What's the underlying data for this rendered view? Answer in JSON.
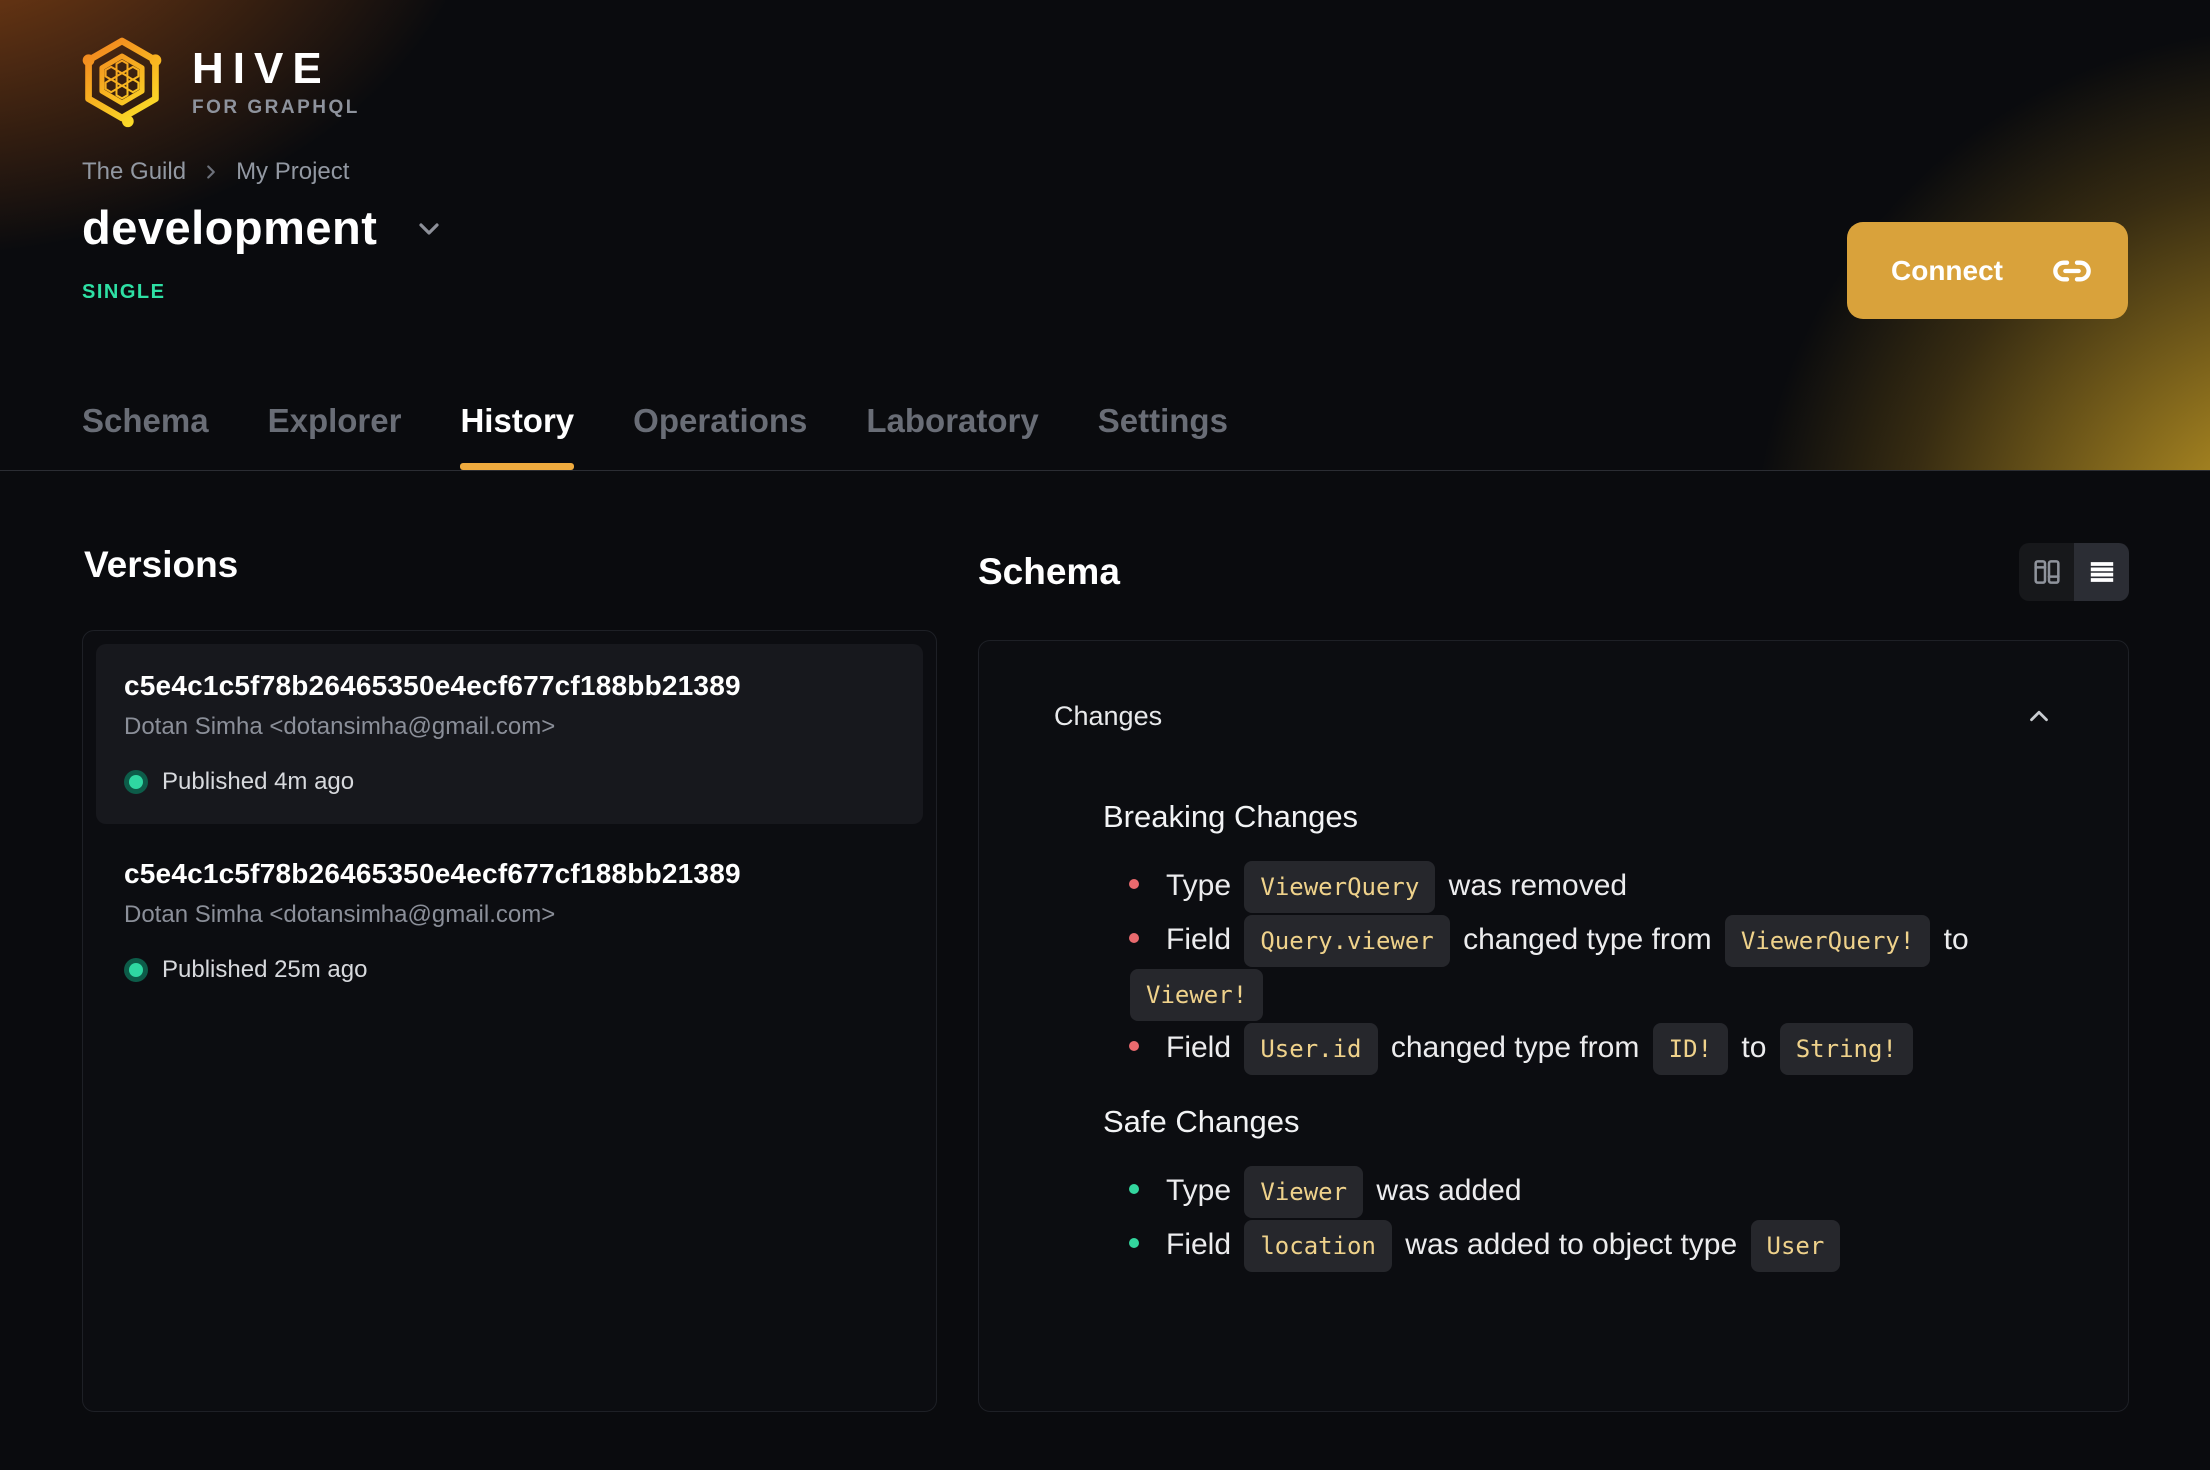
{
  "brand": {
    "name": "HIVE",
    "tagline": "FOR GRAPHQL"
  },
  "breadcrumb": {
    "items": [
      "The Guild",
      "My Project"
    ]
  },
  "header": {
    "title": "development",
    "badge": "SINGLE",
    "connect_label": "Connect"
  },
  "tabs": {
    "items": [
      {
        "label": "Schema",
        "active": false
      },
      {
        "label": "Explorer",
        "active": false
      },
      {
        "label": "History",
        "active": true
      },
      {
        "label": "Operations",
        "active": false
      },
      {
        "label": "Laboratory",
        "active": false
      },
      {
        "label": "Settings",
        "active": false
      }
    ]
  },
  "versions": {
    "heading": "Versions",
    "items": [
      {
        "hash": "c5e4c1c5f78b26465350e4ecf677cf188bb21389",
        "author": "Dotan Simha <dotansimha@gmail.com>",
        "status": "Published 4m ago",
        "highlighted": true
      },
      {
        "hash": "c5e4c1c5f78b26465350e4ecf677cf188bb21389",
        "author": "Dotan Simha <dotansimha@gmail.com>",
        "status": "Published 25m ago",
        "highlighted": false
      }
    ]
  },
  "schema_panel": {
    "heading": "Schema",
    "changes_label": "Changes",
    "view_toggle": [
      {
        "icon": "columns-icon",
        "active": false
      },
      {
        "icon": "rows-icon",
        "active": true
      }
    ],
    "sections": [
      {
        "title": "Breaking Changes",
        "kind": "breaking",
        "items": [
          [
            "Type ",
            {
              "code": "ViewerQuery"
            },
            " was removed"
          ],
          [
            "Field ",
            {
              "code": "Query.viewer"
            },
            " changed type from ",
            {
              "code": "ViewerQuery!"
            },
            " to ",
            {
              "code": "Viewer!"
            }
          ],
          [
            "Field ",
            {
              "code": "User.id"
            },
            " changed type from ",
            {
              "code": "ID!"
            },
            " to ",
            {
              "code": "String!"
            }
          ]
        ]
      },
      {
        "title": "Safe Changes",
        "kind": "safe",
        "items": [
          [
            "Type ",
            {
              "code": "Viewer"
            },
            " was added"
          ],
          [
            "Field ",
            {
              "code": "location"
            },
            " was added to object type ",
            {
              "code": "User"
            }
          ]
        ]
      }
    ]
  },
  "colors": {
    "accent_button": "#d9a23b",
    "tab_underline": "#efab3e",
    "badge_green": "#2ee0a4",
    "status_dot": "#2fd7a2",
    "status_dot_ring": "#0d5c49",
    "code_text": "#efd28b",
    "code_bg": "#26272c",
    "breaking_bullet": "#e96a6e",
    "safe_bullet": "#33d69e"
  }
}
